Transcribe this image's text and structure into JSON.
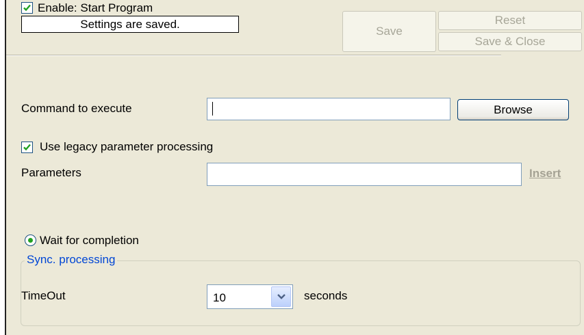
{
  "header": {
    "enable_label": "Enable: Start Program",
    "enable_checked": true,
    "status_text": "Settings are saved.",
    "save_label": "Save",
    "reset_label": "Reset",
    "save_close_label": "Save & Close"
  },
  "command": {
    "label": "Command to execute",
    "value": "",
    "browse_label": "Browse"
  },
  "legacy": {
    "label": "Use legacy parameter processing",
    "checked": true
  },
  "parameters": {
    "label": "Parameters",
    "value": "",
    "insert_label": "Insert"
  },
  "wait": {
    "label": "Wait for completion",
    "selected": true
  },
  "sync": {
    "group_title": "Sync. processing",
    "timeout_label": "TimeOut",
    "timeout_value": "10",
    "unit_label": "seconds"
  },
  "colors": {
    "panel_bg": "#ece9d8",
    "check_green": "#21a121",
    "group_title": "#0046d5",
    "disabled_text": "#a7a698"
  }
}
